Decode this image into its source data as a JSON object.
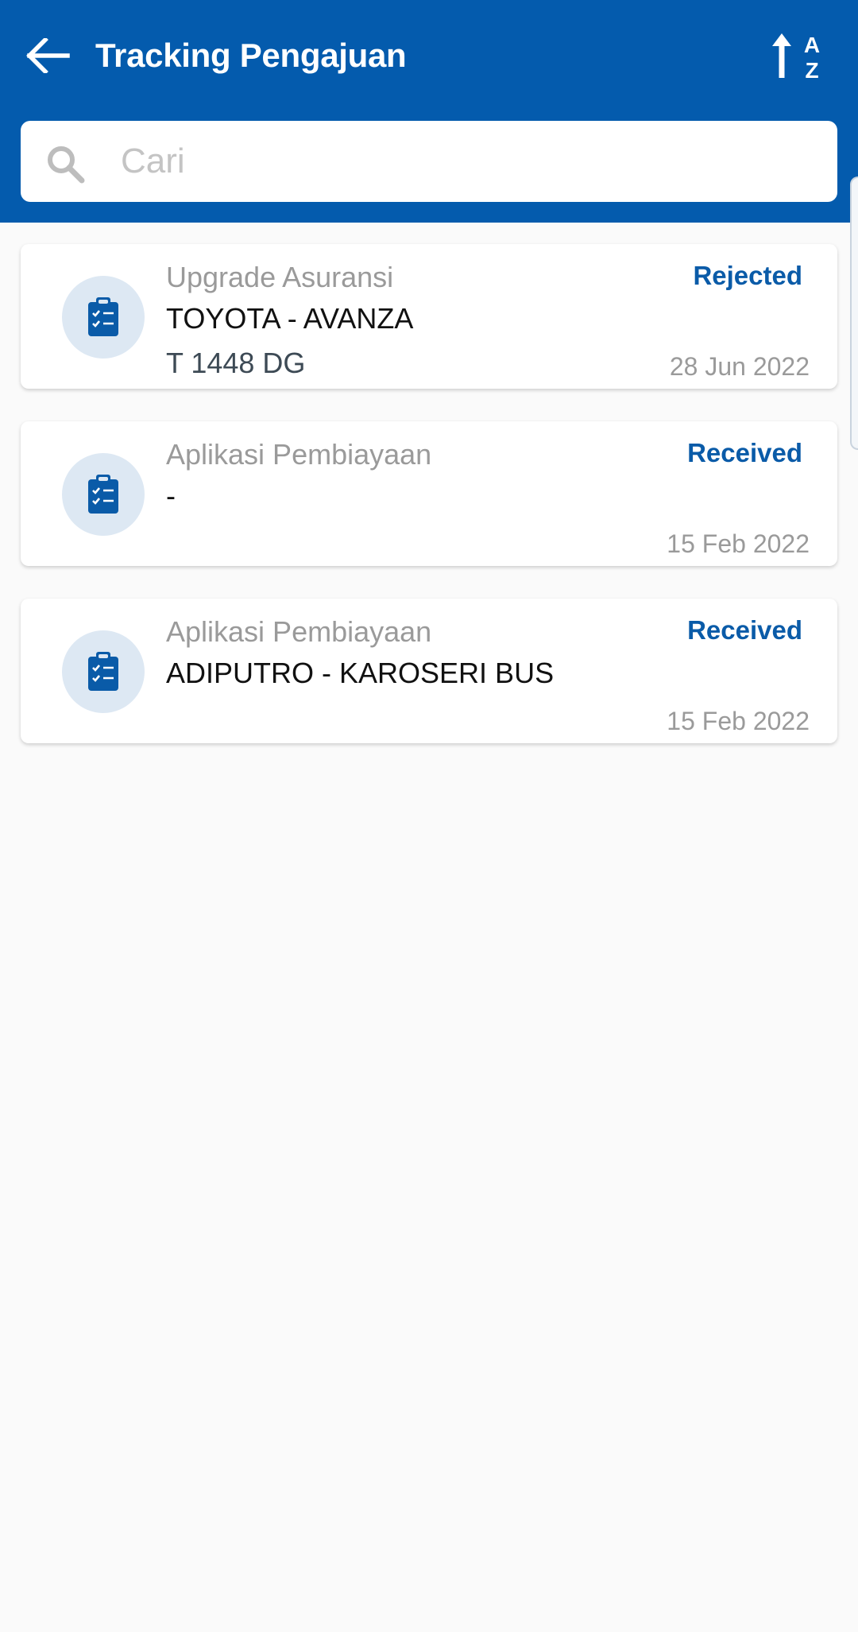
{
  "header": {
    "title": "Tracking Pengajuan",
    "back_icon": "arrow-left-icon",
    "sort_icon": "sort-az-icon",
    "background_color": "#045bad"
  },
  "search": {
    "placeholder": "Cari",
    "value": "",
    "icon": "search-icon"
  },
  "colors": {
    "accent": "#045bad",
    "status": "#0a5ba8",
    "icon_circle": "#dde8f3"
  },
  "items": [
    {
      "type": "Upgrade Asuransi",
      "name": "TOYOTA - AVANZA",
      "plate": "T 1448 DG",
      "status": "Rejected",
      "date": "28 Jun 2022",
      "icon": "clipboard-check-icon"
    },
    {
      "type": "Aplikasi Pembiayaan",
      "name": "-",
      "plate": "",
      "status": "Received",
      "date": "15 Feb 2022",
      "icon": "clipboard-check-icon"
    },
    {
      "type": "Aplikasi Pembiayaan",
      "name": "ADIPUTRO - KAROSERI BUS",
      "plate": "",
      "status": "Received",
      "date": "15 Feb 2022",
      "icon": "clipboard-check-icon"
    }
  ]
}
